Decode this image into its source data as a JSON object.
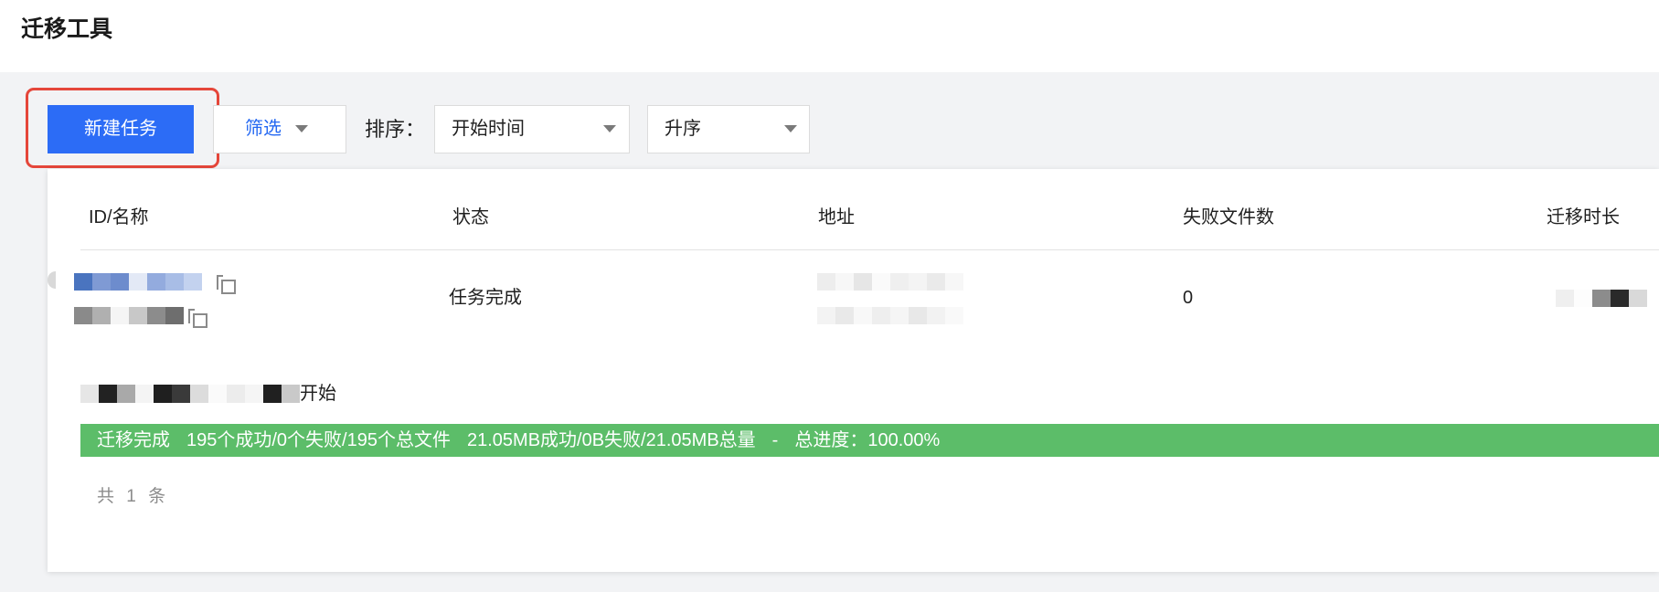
{
  "header": {
    "title": "迁移工具"
  },
  "toolbar": {
    "new_task_label": "新建任务",
    "filter_label": "筛选",
    "sort_label": "排序：",
    "sort_field": "开始时间",
    "sort_order": "升序"
  },
  "table": {
    "columns": [
      "ID/名称",
      "状态",
      "地址",
      "失败文件数",
      "迁移时长"
    ],
    "rows": [
      {
        "status": "任务完成",
        "failed_files": "0"
      }
    ]
  },
  "task": {
    "start_suffix": "开始",
    "progress": {
      "status": "迁移完成",
      "files": "195个成功/0个失败/195个总文件",
      "size": "21.05MB成功/0B失败/21.05MB总量",
      "separator": "-",
      "total": "总进度：100.00%",
      "percent": 100
    }
  },
  "pagination": {
    "total_text": "共 1 条"
  },
  "colors": {
    "primary": "#2c6cf6",
    "highlight": "#e5463a",
    "success": "#5cbd69",
    "link": "#2468f2",
    "background": "#f2f3f5"
  },
  "icons": [
    "caret-down-icon",
    "copy-icon"
  ]
}
